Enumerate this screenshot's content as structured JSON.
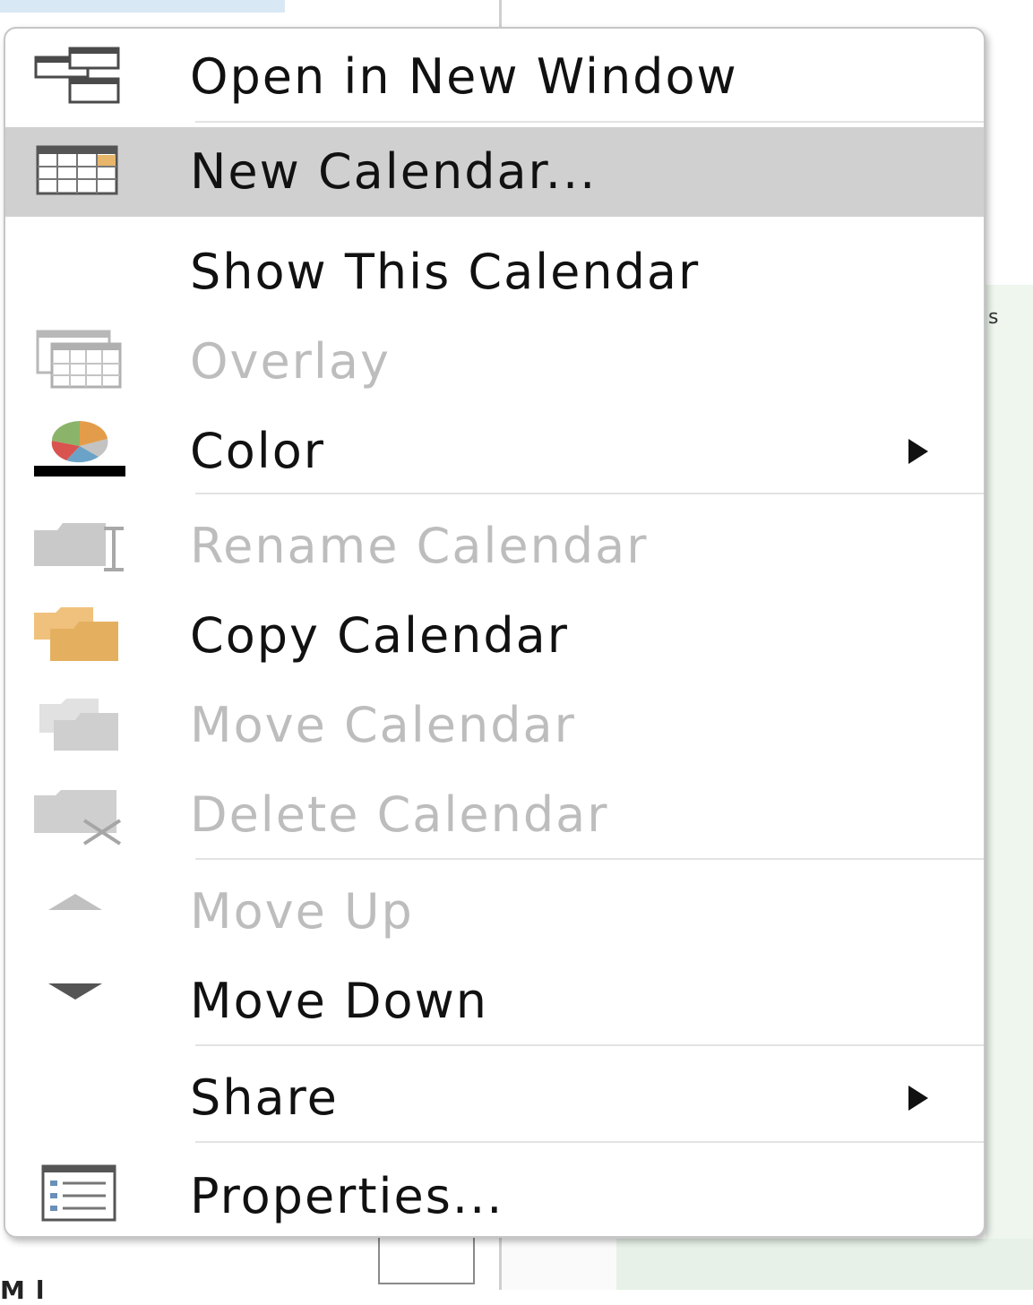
{
  "background": {
    "right_letter": "s",
    "bottom_fragment": "Ml"
  },
  "menu": {
    "items": [
      {
        "label": "Open in New Window",
        "icon": "new-window-icon",
        "enabled": true
      },
      {
        "label": "New Calendar...",
        "icon": "calendar-grid-icon",
        "enabled": true,
        "highlighted": true
      },
      {
        "label": "Show This Calendar",
        "icon": "",
        "enabled": true
      },
      {
        "label": "Overlay",
        "icon": "overlay-calendar-icon",
        "enabled": false
      },
      {
        "label": "Color",
        "icon": "color-palette-icon",
        "enabled": true,
        "submenu": true
      },
      {
        "label": "Rename Calendar",
        "icon": "rename-folder-icon",
        "enabled": false
      },
      {
        "label": "Copy Calendar",
        "icon": "copy-folder-icon",
        "enabled": true
      },
      {
        "label": "Move Calendar",
        "icon": "move-folder-icon",
        "enabled": false
      },
      {
        "label": "Delete Calendar",
        "icon": "delete-folder-icon",
        "enabled": false
      },
      {
        "label": "Move Up",
        "icon": "move-up-icon",
        "enabled": false
      },
      {
        "label": "Move Down",
        "icon": "move-down-icon",
        "enabled": true
      },
      {
        "label": "Share",
        "icon": "",
        "enabled": true,
        "submenu": true
      },
      {
        "label": "Properties...",
        "icon": "properties-icon",
        "enabled": true
      }
    ]
  },
  "colors": {
    "highlight": "#d0d0d0",
    "disabled_text": "#bdbdbd",
    "text": "#111111"
  }
}
